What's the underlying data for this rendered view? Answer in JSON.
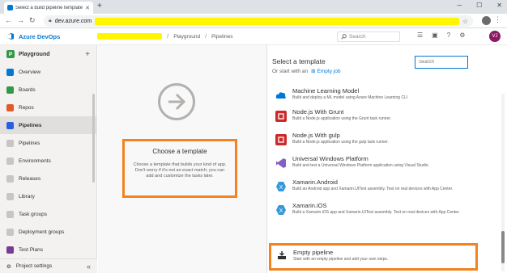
{
  "browser": {
    "tab_title": "Select a build pipeline template",
    "url": "dev.azure.com"
  },
  "header": {
    "product": "Azure DevOps",
    "breadcrumb": [
      "Playground",
      "Pipelines"
    ],
    "search_placeholder": "Search",
    "user_initials": "VJ"
  },
  "sidebar": {
    "project_initial": "P",
    "project_name": "Playground",
    "items": [
      {
        "label": "Overview",
        "color": "#0078d4"
      },
      {
        "label": "Boards",
        "color": "#339947"
      },
      {
        "label": "Repos",
        "color": "#e05b26"
      },
      {
        "label": "Pipelines",
        "color": "#2560e0"
      },
      {
        "label": "Pipelines",
        "color": "#605e5c"
      },
      {
        "label": "Environments",
        "color": "#605e5c"
      },
      {
        "label": "Releases",
        "color": "#605e5c"
      },
      {
        "label": "Library",
        "color": "#605e5c"
      },
      {
        "label": "Task groups",
        "color": "#605e5c"
      },
      {
        "label": "Deployment groups",
        "color": "#605e5c"
      },
      {
        "label": "Test Plans",
        "color": "#773b93"
      }
    ],
    "footer_label": "Project settings"
  },
  "middle": {
    "title": "Choose a template",
    "description": "Choose a template that builds your kind of app. Don't worry if it's not an exact match; you can add and customize the tasks later."
  },
  "templates_panel": {
    "title": "Select a template",
    "or_start": "Or start with an",
    "empty_job": "Empty job",
    "search_placeholder": "Search",
    "items": [
      {
        "name": "Machine Learning Model",
        "desc": "Build and deploy a ML model using Azure Machine Learning CLI",
        "icon": "ml-cloud-icon",
        "color": "#0078d4"
      },
      {
        "name": "Node.js With Grunt",
        "desc": "Build a Node.js application using the Grunt task runner.",
        "icon": "nodejs-icon",
        "color": "#cc2a2a"
      },
      {
        "name": "Node.js With gulp",
        "desc": "Build a Node.js application using the gulp task runner.",
        "icon": "nodejs-icon",
        "color": "#cc2a2a"
      },
      {
        "name": "Universal Windows Platform",
        "desc": "Build and test a Universal Windows Platform application using Visual Studio.",
        "icon": "visual-studio-icon",
        "color": "#865fc5"
      },
      {
        "name": "Xamarin.Android",
        "desc": "Build an Android app and Xamarin.UITest assembly. Test on real devices with App Center.",
        "icon": "xamarin-icon",
        "color": "#3498db"
      },
      {
        "name": "Xamarin.iOS",
        "desc": "Build a Xamarin.iOS app and Xamarin.UITest assembly. Test on real devices with App Center.",
        "icon": "xamarin-icon",
        "color": "#3498db"
      }
    ],
    "empty_pipeline": {
      "name": "Empty pipeline",
      "desc": "Start with an empty pipeline and add your own steps."
    }
  }
}
